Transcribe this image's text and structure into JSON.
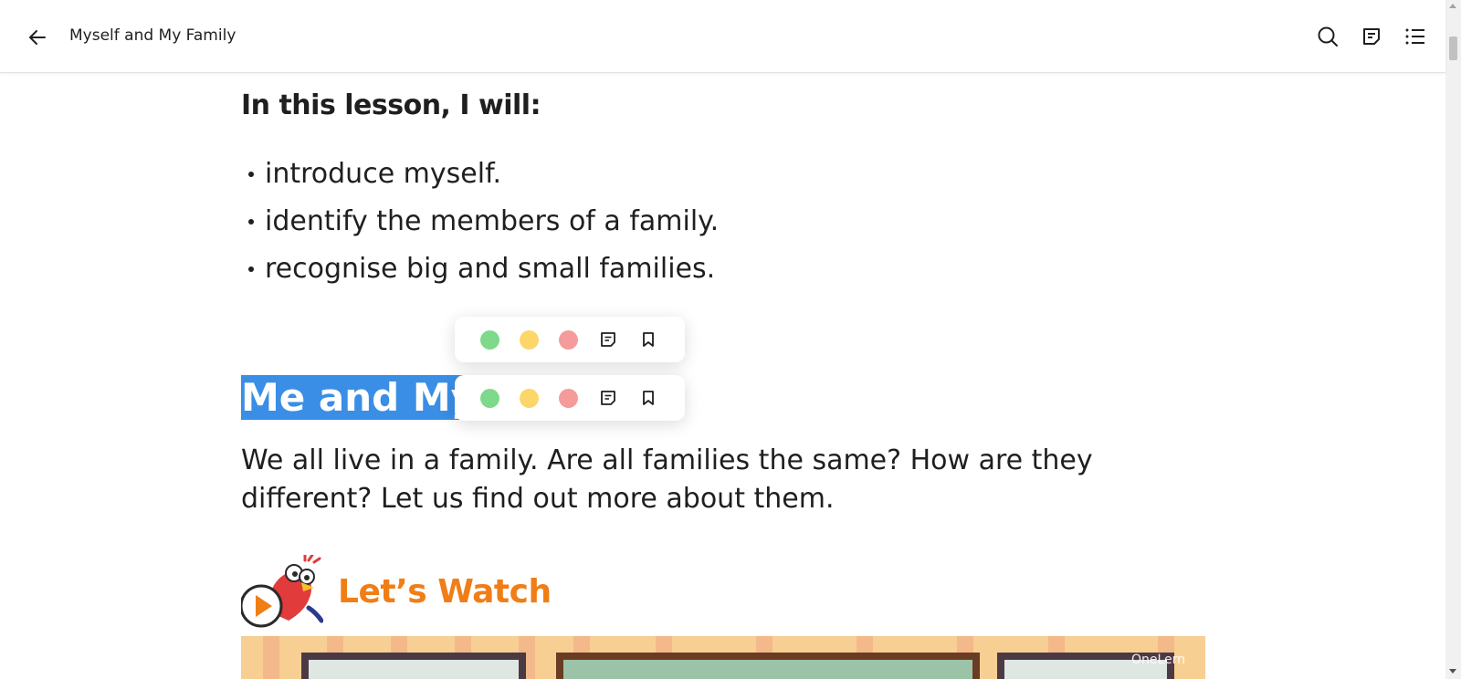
{
  "header": {
    "title": "Myself and My Family",
    "icons": [
      "back-arrow-icon",
      "search-icon",
      "notes-icon",
      "contents-list-icon"
    ]
  },
  "lesson": {
    "heading": "In this lesson, I will:",
    "bullets": [
      "introduce myself.",
      "identify the members of a family.",
      "recognise big and small families."
    ]
  },
  "section": {
    "heading_selected": "Me and My",
    "selection_color": "#3a8ee6"
  },
  "highlight_toolbar": {
    "colors": [
      "#7ed98a",
      "#fdd66a",
      "#f59b9c"
    ],
    "icons": [
      "add-note-icon",
      "bookmark-icon"
    ]
  },
  "paragraph": "We all live in a family. Are all families the same? How are they different? Let us find out more about them.",
  "watch": {
    "label": "Let’s Watch",
    "label_color": "#f07e16"
  },
  "video": {
    "watermark": "OneLern"
  }
}
